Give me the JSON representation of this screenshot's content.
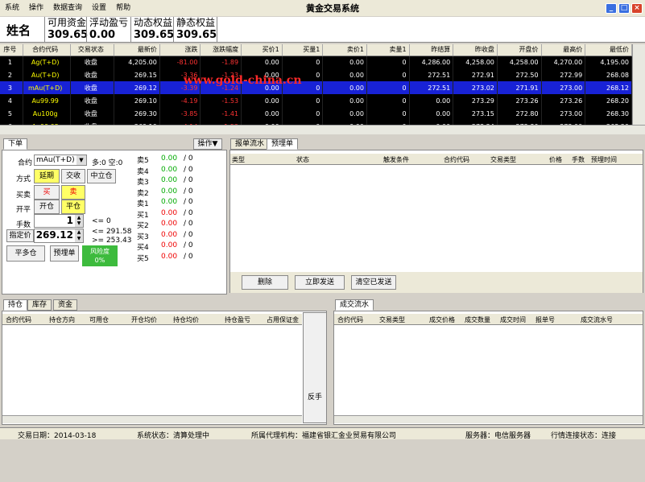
{
  "menu": [
    "系统",
    "操作",
    "数据查询",
    "设置",
    "帮助"
  ],
  "title": "黄金交易系统",
  "account": {
    "name": "姓名",
    "funds": [
      {
        "label": "可用资金",
        "value": "309.65"
      },
      {
        "label": "浮动盈亏",
        "value": "0.00"
      },
      {
        "label": "动态权益",
        "value": "309.65"
      },
      {
        "label": "静态权益",
        "value": "309.65"
      }
    ]
  },
  "quote_headers": [
    "序号",
    "合约代码",
    "交易状态",
    "最新价",
    "涨跌",
    "涨跌幅度",
    "买价1",
    "买量1",
    "卖价1",
    "卖量1",
    "昨结算",
    "昨收盘",
    "开盘价",
    "最高价",
    "最低价"
  ],
  "quotes": [
    [
      "1",
      "Ag(T+D)",
      "收盘",
      "4,205.00",
      "-81.00",
      "-1.89",
      "0.00",
      "0",
      "0.00",
      "0",
      "4,286.00",
      "4,258.00",
      "4,258.00",
      "4,270.00",
      "4,195.00"
    ],
    [
      "2",
      "Au(T+D)",
      "收盘",
      "269.15",
      "-3.36",
      "-1.23",
      "0.00",
      "0",
      "0.00",
      "0",
      "272.51",
      "272.91",
      "272.50",
      "272.99",
      "268.08"
    ],
    [
      "3",
      "mAu(T+D)",
      "收盘",
      "269.12",
      "-3.39",
      "-1.24",
      "0.00",
      "0",
      "0.00",
      "0",
      "272.51",
      "273.02",
      "271.91",
      "273.00",
      "268.12"
    ],
    [
      "4",
      "Au99.99",
      "收盘",
      "269.10",
      "-4.19",
      "-1.53",
      "0.00",
      "0",
      "0.00",
      "0",
      "0.00",
      "273.29",
      "273.26",
      "273.26",
      "268.20"
    ],
    [
      "5",
      "Au100g",
      "收盘",
      "269.30",
      "-3.85",
      "-1.41",
      "0.00",
      "0",
      "0.00",
      "0",
      "0.00",
      "273.15",
      "272.80",
      "273.00",
      "268.30"
    ],
    [
      "6",
      "Au99.95",
      "收盘",
      "269.10",
      "-4.14",
      "-1.52",
      "0.00",
      "0",
      "0.00",
      "0",
      "0.00",
      "273.24",
      "272.80",
      "273.00",
      "268.20"
    ]
  ],
  "watermark": "www.gold-china.cn",
  "order": {
    "tab": "下单",
    "ops": "操作▼",
    "contract_label": "合约",
    "contract_value": "mAu(T+D)",
    "position_info": "多:0 空:0",
    "mode_label": "方式",
    "modes": [
      "延期",
      "交收",
      "中立仓"
    ],
    "side_label": "买卖",
    "buy": "买",
    "sell": "卖",
    "oc_label": "开平",
    "open": "开仓",
    "close": "平仓",
    "qty_label": "手数",
    "qty": "1",
    "qty_limit": "<= 0",
    "price_label": "指定价",
    "price": "269.12",
    "price_hi": "<= 291.58",
    "price_lo": ">= 253.43",
    "btn_flat": "平多仓",
    "btn_preset": "预埋单",
    "risk_label": "风险度",
    "risk_value": "0%"
  },
  "depth": [
    {
      "label": "卖5",
      "price": "0.00",
      "vol": "/ 0"
    },
    {
      "label": "卖4",
      "price": "0.00",
      "vol": "/ 0"
    },
    {
      "label": "卖3",
      "price": "0.00",
      "vol": "/ 0"
    },
    {
      "label": "卖2",
      "price": "0.00",
      "vol": "/ 0"
    },
    {
      "label": "卖1",
      "price": "0.00",
      "vol": "/ 0"
    },
    {
      "label": "买1",
      "price": "0.00",
      "vol": "/ 0"
    },
    {
      "label": "买2",
      "price": "0.00",
      "vol": "/ 0"
    },
    {
      "label": "买3",
      "price": "0.00",
      "vol": "/ 0"
    },
    {
      "label": "买4",
      "price": "0.00",
      "vol": "/ 0"
    },
    {
      "label": "买5",
      "price": "0.00",
      "vol": "/ 0"
    }
  ],
  "preset": {
    "tabs": [
      "报单流水",
      "预埋单"
    ],
    "headers": [
      "类型",
      "状态",
      "触发条件",
      "合约代码",
      "交易类型",
      "价格",
      "手数",
      "预埋时间"
    ],
    "buttons": [
      "删除",
      "立即发送",
      "清空已发送"
    ]
  },
  "pos": {
    "tabs": [
      "持仓",
      "库存",
      "资金"
    ],
    "headers": [
      "合约代码",
      "持仓方向",
      "可用仓",
      "开仓均价",
      "持仓均价",
      "持仓盈亏",
      "占用保证金"
    ],
    "reverse": "反手"
  },
  "trades": {
    "tab": "成交流水",
    "headers": [
      "合约代码",
      "交易类型",
      "成交价格",
      "成交数量",
      "成交时间",
      "报单号",
      "成交流水号"
    ]
  },
  "status": {
    "date": "交易日期：2014-03-18",
    "sys": "系统状态：清算处理中",
    "org": "所属代理机构：福建省银汇金业贸易有限公司",
    "server": "服务器：电信服务器",
    "conn": "行情连接状态：连接"
  }
}
